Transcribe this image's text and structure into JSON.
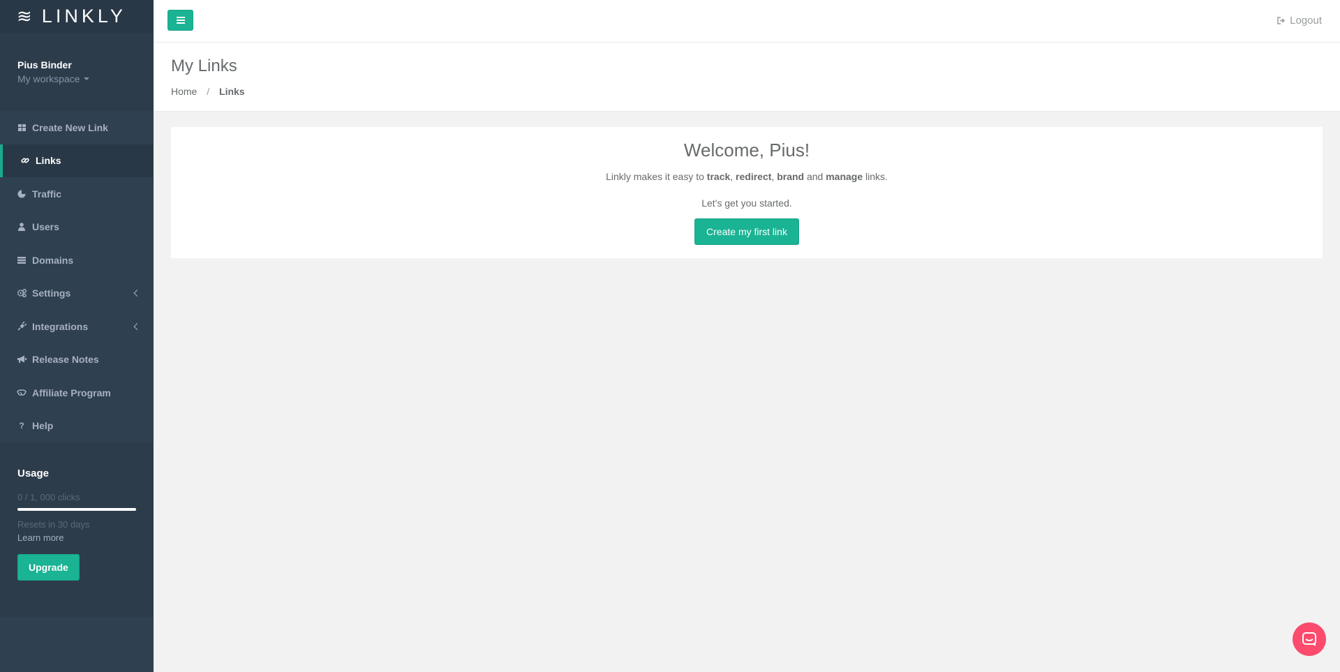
{
  "brand": {
    "logo_mark": "≋",
    "name": "LINKLY"
  },
  "profile": {
    "name": "Pius Binder",
    "workspace": "My workspace"
  },
  "nav": [
    {
      "label": "Create New Link",
      "icon": "grid-icon"
    },
    {
      "label": "Links",
      "icon": "link-icon",
      "active": true
    },
    {
      "label": "Traffic",
      "icon": "pie-chart-icon"
    },
    {
      "label": "Users",
      "icon": "user-icon"
    },
    {
      "label": "Domains",
      "icon": "list-icon"
    },
    {
      "label": "Settings",
      "icon": "gears-icon",
      "expandable": true
    },
    {
      "label": "Integrations",
      "icon": "plug-icon",
      "expandable": true
    },
    {
      "label": "Release Notes",
      "icon": "bullhorn-icon"
    },
    {
      "label": "Affiliate Program",
      "icon": "handshake-icon"
    },
    {
      "label": "Help",
      "icon": "question-icon",
      "glyph": "?"
    }
  ],
  "usage": {
    "title": "Usage",
    "clicks": "0 / 1, 000 clicks",
    "progress_fraction": 0,
    "resets": "Resets in 30 days",
    "learn_more": "Learn more",
    "upgrade": "Upgrade"
  },
  "topbar": {
    "logout": "Logout"
  },
  "heading": {
    "title": "My Links",
    "crumb_home": "Home",
    "crumb_sep": "/",
    "crumb_current": "Links"
  },
  "welcome": {
    "title": "Welcome, Pius!",
    "line1": {
      "t1": "Linkly makes it easy to ",
      "b1": "track",
      "t2": ", ",
      "b2": "redirect",
      "t3": ", ",
      "b3": "brand",
      "t4": " and ",
      "b4": "manage",
      "t5": " links."
    },
    "line2": "Let's get you started.",
    "button": "Create my first link"
  },
  "colors": {
    "accent": "#1ab394",
    "sidebar": "#2f4050",
    "chat": "#fc4b6c"
  }
}
